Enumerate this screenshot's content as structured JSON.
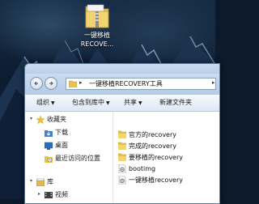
{
  "desktop": {
    "icon_label_line1": "一键移植",
    "icon_label_line2": "RECOVE..."
  },
  "window": {
    "address_path": "一键移植RECOVERY工具",
    "toolbar": [
      {
        "label": "组织"
      },
      {
        "label": "包含到库中"
      },
      {
        "label": "共享"
      },
      {
        "label": "新建文件夹"
      }
    ],
    "nav_pane": {
      "favorites": "收藏夹",
      "items": [
        "下载",
        "桌面",
        "最近访问的位置"
      ],
      "library": "库",
      "library_items": [
        "视频"
      ]
    },
    "files": [
      {
        "name": "官方的recovery",
        "icon": "folder-icon"
      },
      {
        "name": "完成的recovery",
        "icon": "folder-icon"
      },
      {
        "name": "要移植的recovery",
        "icon": "folder-icon"
      },
      {
        "name": "bootimg",
        "icon": "gear-file-icon"
      },
      {
        "name": "一键移植recovery",
        "icon": "gear-file-icon"
      }
    ]
  },
  "colors": {
    "folder": "#e8c150",
    "window_chrome": "#c9dcf0",
    "desktop": "#0d1a2c"
  }
}
